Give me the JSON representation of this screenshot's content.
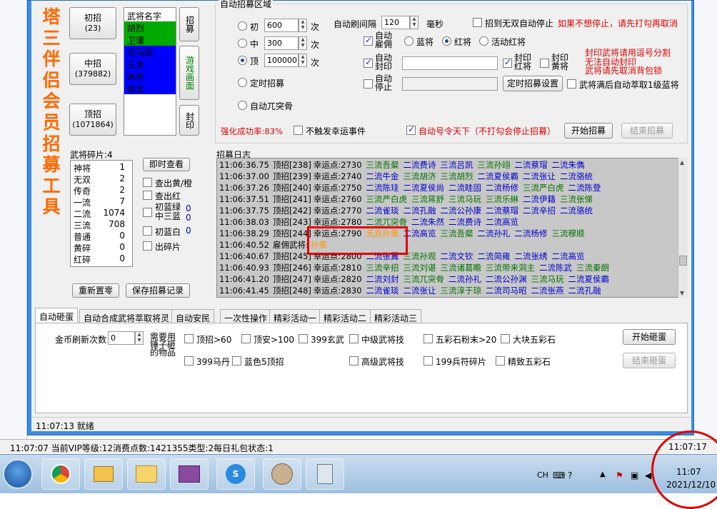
{
  "app": {
    "title_vertical": "塔三伴侣会员招募工具",
    "left_buttons": [
      {
        "label": "初招",
        "sub": "(23)"
      },
      {
        "label": "中招",
        "sub": "(379882)"
      },
      {
        "label": "顶招",
        "sub": "(1071864)"
      }
    ],
    "hero_list": {
      "header": "武将名字",
      "items": [
        "胡烈",
        "卫瓘",
        "司马昭",
        "王凌",
        "朱然",
        "高览"
      ],
      "item_colors": [
        "#00aa00",
        "#00aa00",
        "#0000ff",
        "#0000ff",
        "#0000ff",
        "#0000ff"
      ]
    },
    "side_buttons": [
      "招募",
      "游戏画面",
      "封印"
    ],
    "fragments": {
      "title": "武将碎片:4",
      "rows": [
        {
          "name": "神将",
          "value": "1"
        },
        {
          "name": "无双",
          "value": "2"
        },
        {
          "name": "传奇",
          "value": "2"
        },
        {
          "name": "一流",
          "value": "7"
        },
        {
          "name": "二流",
          "value": "1074"
        },
        {
          "name": "三流",
          "value": "708"
        },
        {
          "name": "普通",
          "value": "0"
        },
        {
          "name": "黄碎",
          "value": "0"
        },
        {
          "name": "红碎",
          "value": "0"
        }
      ],
      "view_button": "即时查看",
      "checks": [
        {
          "label": "查出黄/橙",
          "checked": false
        },
        {
          "label": "查出红",
          "checked": false
        },
        {
          "label": "初蓝绿\n中三蓝",
          "value": "0\n0",
          "checked": false
        },
        {
          "label": "初蓝白",
          "value": "0",
          "checked": false
        },
        {
          "label": "出碎片",
          "checked": false
        }
      ],
      "reset_button": "重新置零",
      "save_button": "保存招募记录"
    },
    "auto_area": {
      "title": "自动招募区域",
      "levels": [
        {
          "label": "初",
          "value": "600",
          "unit": "次",
          "selected": false
        },
        {
          "label": "中",
          "value": "300",
          "unit": "次",
          "selected": false
        },
        {
          "label": "顶",
          "value": "100000",
          "unit": "次",
          "selected": true
        }
      ],
      "timed_label": "定时招募",
      "wutu_label": "自动兀突骨",
      "interval_label": "自动刷间隔",
      "interval_value": "120",
      "interval_unit": "毫秒",
      "stop_wushuang_label": "招到无双自动停止",
      "stop_hint": "如果不想停止，请先打勾再取消",
      "auto_hire_label": "自动雇佣",
      "color_radios": [
        {
          "label": "蓝将",
          "selected": false
        },
        {
          "label": "红将",
          "selected": true
        },
        {
          "label": "活动红将",
          "selected": false
        }
      ],
      "auto_seal_label": "自动封印",
      "seal_red_label": "封印红将",
      "seal_yellow_label": "封印黄将",
      "seal_hint": "封印武将请用逗号分割\n无法自动封印\n武将请先取消背包锁",
      "auto_stop_label": "自动停止",
      "timed_settings_button": "定时招募设置",
      "full_stop_label": "武将满后自动萃取1级蓝将",
      "strengthen_label": "强化成功率:83%",
      "no_luck_label": "不触发幸运事件",
      "auto_order_label": "自动号令天下（不打勾会停止招募）",
      "start_button": "开始招募",
      "end_button": "结束招募"
    },
    "log": {
      "title": "招募日志",
      "rows": [
        {
          "time": "11:06:36.75",
          "kind": "顶招[238]",
          "luck": "幸运点:2730",
          "heroes": [
            [
              "三流吾粲",
              "g"
            ],
            [
              "二流费诗",
              "b"
            ],
            [
              "三流吕凯",
              "b"
            ],
            [
              "三流孙翊",
              "g"
            ],
            [
              "二流蔡瑁",
              "b"
            ],
            [
              "二流朱儁",
              "b"
            ]
          ]
        },
        {
          "time": "11:06:37.00",
          "kind": "顶招[239]",
          "luck": "幸运点:2740",
          "heroes": [
            [
              "二流牛金",
              "b"
            ],
            [
              "三流胡济",
              "g"
            ],
            [
              "三流胡烈",
              "g"
            ],
            [
              "二流夏侯霸",
              "b"
            ],
            [
              "二流张让",
              "b"
            ],
            [
              "二流骆统",
              "b"
            ]
          ]
        },
        {
          "time": "11:06:37.26",
          "kind": "顶招[240]",
          "luck": "幸运点:2750",
          "heroes": [
            [
              "二流陈珪",
              "b"
            ],
            [
              "二流夏侯尚",
              "b"
            ],
            [
              "二流眭固",
              "b"
            ],
            [
              "二流杨修",
              "b"
            ],
            [
              "三流严白虎",
              "g"
            ],
            [
              "二流陈登",
              "b"
            ]
          ]
        },
        {
          "time": "11:06:37.51",
          "kind": "顶招[241]",
          "luck": "幸运点:2760",
          "heroes": [
            [
              "三流严白虎",
              "g"
            ],
            [
              "三流蒋舒",
              "g"
            ],
            [
              "三流马玩",
              "g"
            ],
            [
              "三流乐綝",
              "g"
            ],
            [
              "二流伊籍",
              "b"
            ],
            [
              "三流张悌",
              "g"
            ]
          ]
        },
        {
          "time": "11:06:37.75",
          "kind": "顶招[242]",
          "luck": "幸运点:2770",
          "heroes": [
            [
              "二流雀琰",
              "b"
            ],
            [
              "二流孔融",
              "b"
            ],
            [
              "二流公孙康",
              "b"
            ],
            [
              "二流蔡瑁",
              "b"
            ],
            [
              "二流辛招",
              "b"
            ],
            [
              "二流骆统",
              "b"
            ]
          ]
        },
        {
          "time": "11:06:38.03",
          "kind": "顶招[243]",
          "luck": "幸运点:2780",
          "heroes": [
            [
              "二流兀突骨",
              "g"
            ],
            [
              "二流朱然",
              "b"
            ],
            [
              "二流费诗",
              "b"
            ],
            [
              "二流高览",
              "b"
            ]
          ]
        },
        {
          "time": "11:06:38.29",
          "kind": "顶招[244]",
          "luck": "幸运点:2790",
          "heroes": [
            [
              "无双孙策",
              "o"
            ],
            [
              "二流高览",
              "b"
            ],
            [
              "三流吾粲",
              "g"
            ],
            [
              "二流孙礼",
              "b"
            ],
            [
              "二流杨修",
              "b"
            ],
            [
              "三流穆顺",
              "g"
            ]
          ]
        },
        {
          "time": "11:06:40.52",
          "kind": "雇佣武将:",
          "luck": "孙策",
          "heroes": []
        },
        {
          "time": "11:06:40.67",
          "kind": "顶招[245]",
          "luck": "幸运点:2800",
          "heroes": [
            [
              "二流张翼",
              "b"
            ],
            [
              "三流孙观",
              "g"
            ],
            [
              "二流文钦",
              "b"
            ],
            [
              "二流简雍",
              "b"
            ],
            [
              "二流张绣",
              "b"
            ],
            [
              "二流高览",
              "b"
            ]
          ]
        },
        {
          "time": "11:06:40.93",
          "kind": "顶招[246]",
          "luck": "幸运点:2810",
          "heroes": [
            [
              "三流辛招",
              "g"
            ],
            [
              "三流刘谌",
              "g"
            ],
            [
              "三流诸葛瞻",
              "g"
            ],
            [
              "三流带来洞主",
              "g"
            ],
            [
              "二流陈武",
              "b"
            ],
            [
              "三流秦朗",
              "g"
            ]
          ]
        },
        {
          "time": "11:06:41.20",
          "kind": "顶招[247]",
          "luck": "幸运点:2820",
          "heroes": [
            [
              "二流刘封",
              "b"
            ],
            [
              "三流兀突骨",
              "g"
            ],
            [
              "二流孙礼",
              "b"
            ],
            [
              "二流公孙渊",
              "b"
            ],
            [
              "三流马玩",
              "g"
            ],
            [
              "二流夏侯霸",
              "b"
            ]
          ]
        },
        {
          "time": "11:06:41.45",
          "kind": "顶招[248]",
          "luck": "幸运点:2830",
          "heroes": [
            [
              "二流雀琰",
              "b"
            ],
            [
              "二流张让",
              "b"
            ],
            [
              "三流淳于琼",
              "g"
            ],
            [
              "二流司马昭",
              "b"
            ],
            [
              "二流张燕",
              "b"
            ],
            [
              "二流孔融",
              "b"
            ]
          ]
        }
      ]
    },
    "tabs": [
      "自动砸蛋",
      "自动合成武将萃取将灵",
      "自动安民",
      "一次性操作",
      "精彩活动一",
      "精彩活动二",
      "精彩活动三"
    ],
    "egg": {
      "refresh_label": "金币刷新次数",
      "refresh_value": "0",
      "need_label": "需要用\n锤子砸\n的物品",
      "items_row1": [
        "顶招>60",
        "顶安>100",
        "399玄武",
        "中级武将技",
        "五彩石粉末>20",
        "大块五彩石"
      ],
      "items_row2": [
        "399马丹",
        "蓝色5顶招",
        "高级武将技",
        "199兵符碎片",
        "精致五彩石"
      ],
      "start_button": "开始砸蛋",
      "end_button": "结束砸蛋"
    },
    "status": "11:07:13 就绪"
  },
  "outer": {
    "status_left": "11:07:07 当前VIP等级:12消费点数:1421355类型:2每日礼包状态:1",
    "status_right": "11:07:17"
  },
  "taskbar": {
    "time": "11:07",
    "date": "2021/12/10",
    "lang": "CH"
  },
  "colors": {
    "accent_orange": "#ff6a00",
    "annotation_red": "#e00000",
    "log_bg": "#c8c8c8"
  }
}
